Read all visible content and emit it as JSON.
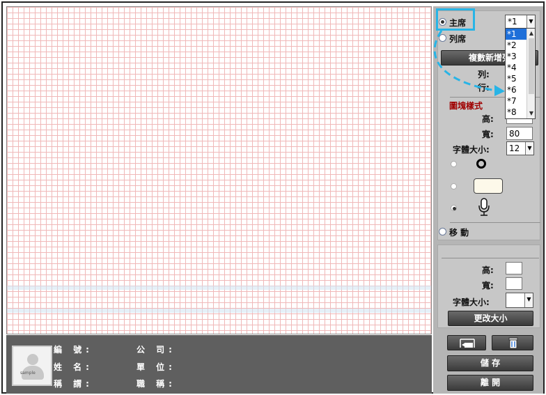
{
  "canvas": {},
  "info": {
    "id_label": "編 號:",
    "company_label": "公 司:",
    "name_label": "姓 名:",
    "unit_label": "單 位:",
    "title_label": "稱 謂:",
    "position_label": "職 稱:",
    "photo_text": "sample"
  },
  "panel": {
    "mode_host": "主席",
    "mode_row": "列席",
    "seat_select_value": "*1",
    "seat_options": [
      "*1",
      "*2",
      "*3",
      "*4",
      "*5",
      "*6",
      "*7",
      "*8"
    ],
    "add_row_button": "複數新增列",
    "col_label": "列:",
    "row_label": "行:",
    "block_style_heading": "圖塊樣式",
    "height_label": "高:",
    "height_value": "",
    "width_label": "寬:",
    "width_value": "80",
    "font_size_label": "字體大小:",
    "font_size_value": "12",
    "shape_circle_selected": false,
    "shape_rect_selected": false,
    "shape_mic_selected": true,
    "move_label": "移 動",
    "resize_height_label": "高:",
    "resize_width_label": "寬:",
    "resize_font_label": "字體大小:",
    "resize_button": "更改大小",
    "save_button": "儲 存",
    "leave_button": "離 開"
  },
  "colors": {
    "highlight": "#28b4e6",
    "grid": "#f0b8b8",
    "accent_red": "#a00000"
  }
}
